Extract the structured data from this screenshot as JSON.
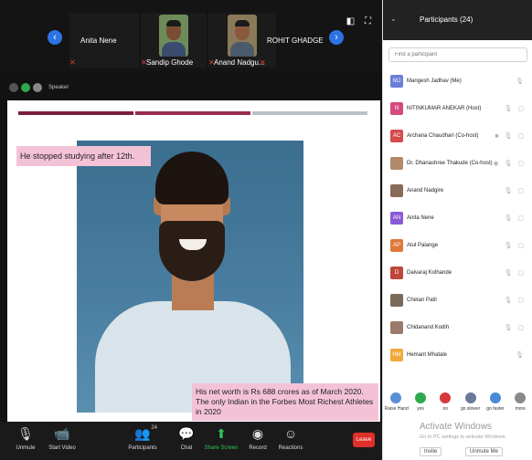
{
  "strip": {
    "prev_icon": "chevron-left-icon",
    "next_icon": "chevron-right-icon",
    "tiles": [
      {
        "name": "Anita Nene",
        "has_video": false
      },
      {
        "name": "Sandip Ghode",
        "has_video": true
      },
      {
        "name": "Anand Nadgu...",
        "has_video": true
      },
      {
        "name": "ROHIT GHADGE",
        "has_video": false
      }
    ]
  },
  "share_label": "Speaker",
  "slide": {
    "caption_top": "He stopped studying after 12th.",
    "caption_bottom": "His net worth is Rs 688 crores as of March 2020. The only Indian in the Forbes Most Richest Athletes in 2020",
    "stripe_colors": [
      "#7b1f3a",
      "#9c2a4e",
      "#b8c2cc"
    ]
  },
  "toolbar": {
    "unmute": "Unmute",
    "start_video": "Start Video",
    "participants": "Participants",
    "participants_count": "24",
    "chat": "Chat",
    "share_screen": "Share Screen",
    "record": "Record",
    "reactions": "Reactions",
    "leave": "Leave"
  },
  "panel": {
    "title": "Participants (24)",
    "search_placeholder": "Find a participant",
    "participants": [
      {
        "initials": "MJ",
        "color": "#6a7fd6",
        "name": "Mangesh Jadhav (Me)",
        "icons": "🎙"
      },
      {
        "initials": "N",
        "color": "#d64a7f",
        "name": "NITINKUMAR ANEKAR (Host)",
        "icons": "🎙 ▢"
      },
      {
        "initials": "AC",
        "color": "#d64a4a",
        "name": "Archana Chaudhari (Co-host)",
        "icons": "■ 🎙 ▢"
      },
      {
        "initials": "",
        "color": "#b08a6a",
        "name": "Dr. Dhanashree Thakude (Co-host)",
        "icons": "◉ 🎙 ▢"
      },
      {
        "initials": "",
        "color": "#8a6a5a",
        "name": "Anand Nadgire",
        "icons": "🎙 ▢"
      },
      {
        "initials": "AN",
        "color": "#8a5ad6",
        "name": "Anita Nene",
        "icons": "🎙 ▢"
      },
      {
        "initials": "AP",
        "color": "#e0783a",
        "name": "Atul Palange",
        "icons": "🎙 ▢"
      },
      {
        "initials": "D",
        "color": "#c0453a",
        "name": "Daivaraj Kolhande",
        "icons": "🎙 ▢"
      },
      {
        "initials": "",
        "color": "#7a6a5a",
        "name": "Chetan Patil",
        "icons": "🎙 ▢"
      },
      {
        "initials": "",
        "color": "#9a7a6a",
        "name": "Chidanand Kodih",
        "icons": "🎙 ▢"
      },
      {
        "initials": "HM",
        "color": "#f0a83a",
        "name": "Hemant Mhatale",
        "icons": "🎙"
      }
    ],
    "reactions": [
      {
        "label": "Raise Hand",
        "color": "#5a8fd6"
      },
      {
        "label": "yes",
        "color": "#2fa84f"
      },
      {
        "label": "no",
        "color": "#d63a3a"
      },
      {
        "label": "go slower",
        "color": "#6a7a9a"
      },
      {
        "label": "go faster",
        "color": "#4a8ad6"
      },
      {
        "label": "more",
        "color": "#8a8a8a"
      }
    ],
    "watermark": "Activate Windows",
    "watermark_sub": "Go to PC settings to activate Windows.",
    "invite": "Invite",
    "unmute_me": "Unmute Me"
  }
}
